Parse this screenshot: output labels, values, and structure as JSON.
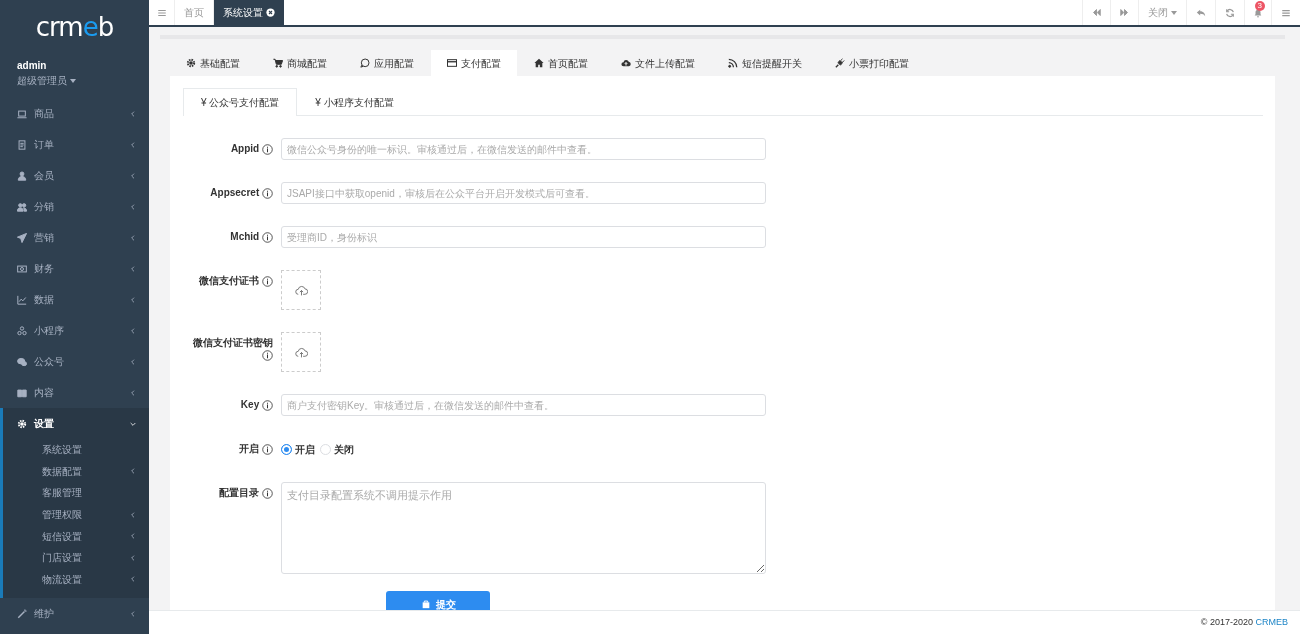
{
  "topbar": {
    "tabs": [
      {
        "label": "首页",
        "selected": false
      },
      {
        "label": "系统设置",
        "selected": true
      }
    ],
    "close_menu": "关闭",
    "notification_count": "3"
  },
  "sidebar": {
    "logo": "crmeb",
    "user": {
      "name": "admin",
      "role": "超级管理员"
    },
    "menu": [
      {
        "label": "商品",
        "expanded": false
      },
      {
        "label": "订单",
        "expanded": false
      },
      {
        "label": "会员",
        "expanded": false
      },
      {
        "label": "分销",
        "expanded": false
      },
      {
        "label": "营销",
        "expanded": false
      },
      {
        "label": "财务",
        "expanded": false
      },
      {
        "label": "数据",
        "expanded": false
      },
      {
        "label": "小程序",
        "expanded": false
      },
      {
        "label": "公众号",
        "expanded": false
      },
      {
        "label": "内容",
        "expanded": false
      },
      {
        "label": "设置",
        "expanded": true,
        "children": [
          {
            "label": "系统设置",
            "expandable": false
          },
          {
            "label": "数据配置",
            "expandable": true
          },
          {
            "label": "客服管理",
            "expandable": false
          },
          {
            "label": "管理权限",
            "expandable": true
          },
          {
            "label": "短信设置",
            "expandable": true
          },
          {
            "label": "门店设置",
            "expandable": true
          },
          {
            "label": "物流设置",
            "expandable": true
          }
        ]
      },
      {
        "label": "维护",
        "expanded": false
      }
    ]
  },
  "config_tabs": [
    {
      "label": "基础配置",
      "selected": false
    },
    {
      "label": "商城配置",
      "selected": false
    },
    {
      "label": "应用配置",
      "selected": false
    },
    {
      "label": "支付配置",
      "selected": true
    },
    {
      "label": "首页配置",
      "selected": false
    },
    {
      "label": "文件上传配置",
      "selected": false
    },
    {
      "label": "短信提醒开关",
      "selected": false
    },
    {
      "label": "小票打印配置",
      "selected": false
    }
  ],
  "sub_tabs": [
    {
      "label": "¥ 公众号支付配置",
      "selected": true
    },
    {
      "label": "¥ 小程序支付配置",
      "selected": false
    }
  ],
  "form": {
    "fields": [
      {
        "kind": "text",
        "label": "Appid",
        "placeholder": "微信公众号身份的唯一标识。审核通过后，在微信发送的邮件中查看。"
      },
      {
        "kind": "text",
        "label": "Appsecret",
        "placeholder": "JSAPI接口中获取openid，审核后在公众平台开启开发模式后可查看。"
      },
      {
        "kind": "text",
        "label": "Mchid",
        "placeholder": "受理商ID，身份标识"
      },
      {
        "kind": "upload",
        "label": "微信支付证书"
      },
      {
        "kind": "upload",
        "label": "微信支付证书密钥"
      },
      {
        "kind": "text",
        "label": "Key",
        "placeholder": "商户支付密钥Key。审核通过后，在微信发送的邮件中查看。"
      },
      {
        "kind": "radio",
        "label": "开启",
        "options": [
          {
            "label": "开启",
            "selected": true
          },
          {
            "label": "关闭",
            "selected": false
          }
        ]
      },
      {
        "kind": "textarea",
        "label": "配置目录",
        "placeholder": "支付目录配置系统不调用提示作用"
      }
    ],
    "submit": "提交"
  },
  "footer": {
    "copyright": "© 2017-2020",
    "link": "CRMEB"
  }
}
